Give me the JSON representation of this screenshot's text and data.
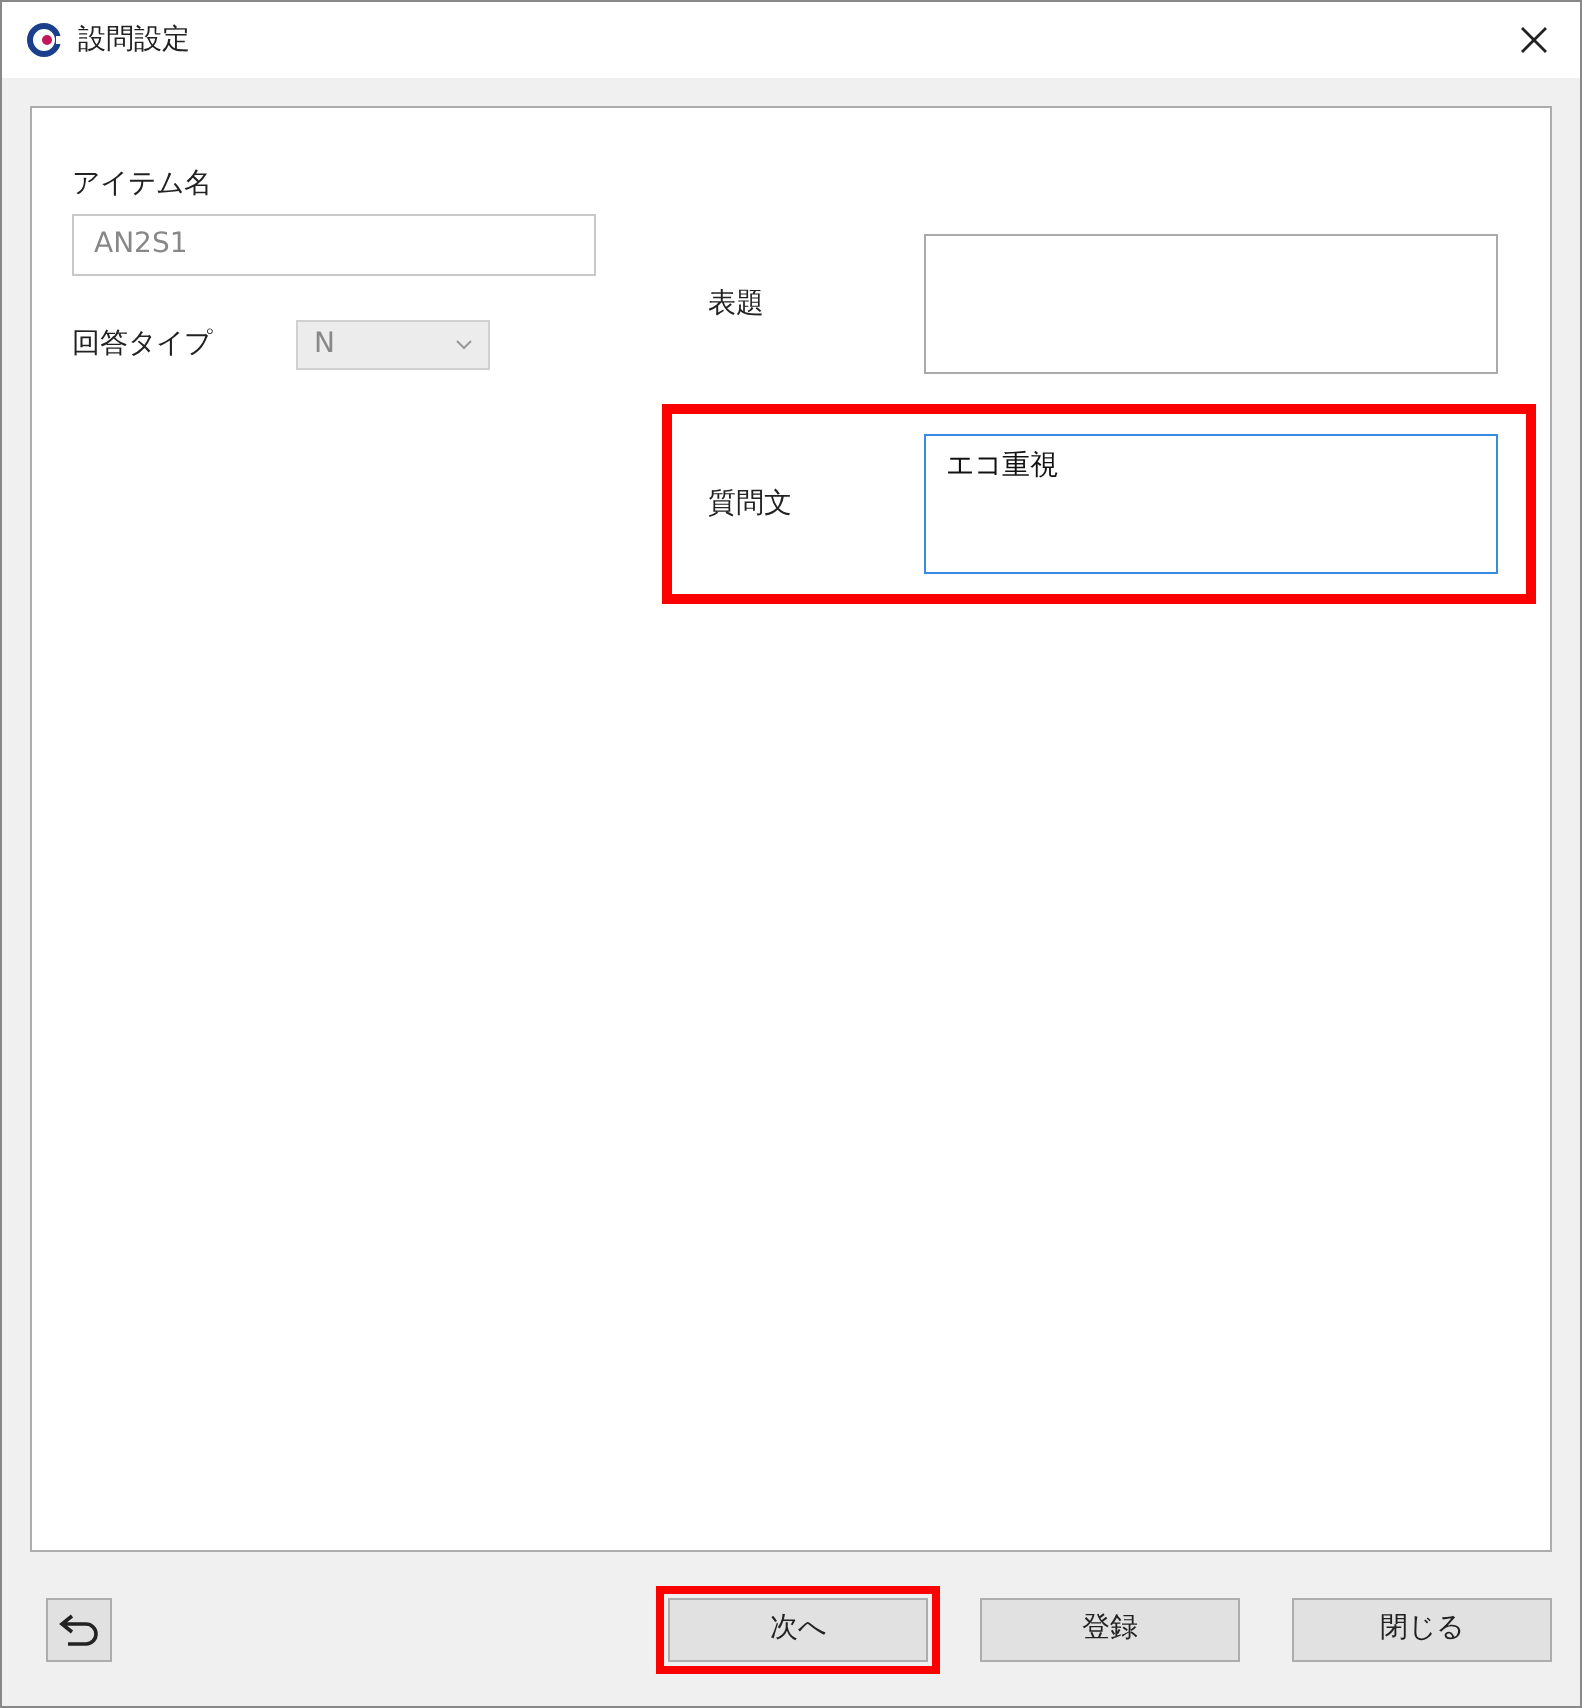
{
  "window": {
    "title": "設問設定"
  },
  "item_name": {
    "label": "アイテム名",
    "value": "AN2S1",
    "disabled": true
  },
  "answer_type": {
    "label": "回答タイプ",
    "value": "N",
    "disabled": true
  },
  "fields": [
    {
      "label": "表題",
      "focused": false,
      "highlighted": false
    },
    {
      "label": "質問文",
      "value": "エコ重視",
      "focused": true,
      "highlighted": true
    }
  ],
  "buttons": [
    {
      "label": "次へ",
      "highlighted": true
    },
    {
      "label": "登録",
      "highlighted": false
    },
    {
      "label": "閉じる",
      "highlighted": false
    }
  ]
}
